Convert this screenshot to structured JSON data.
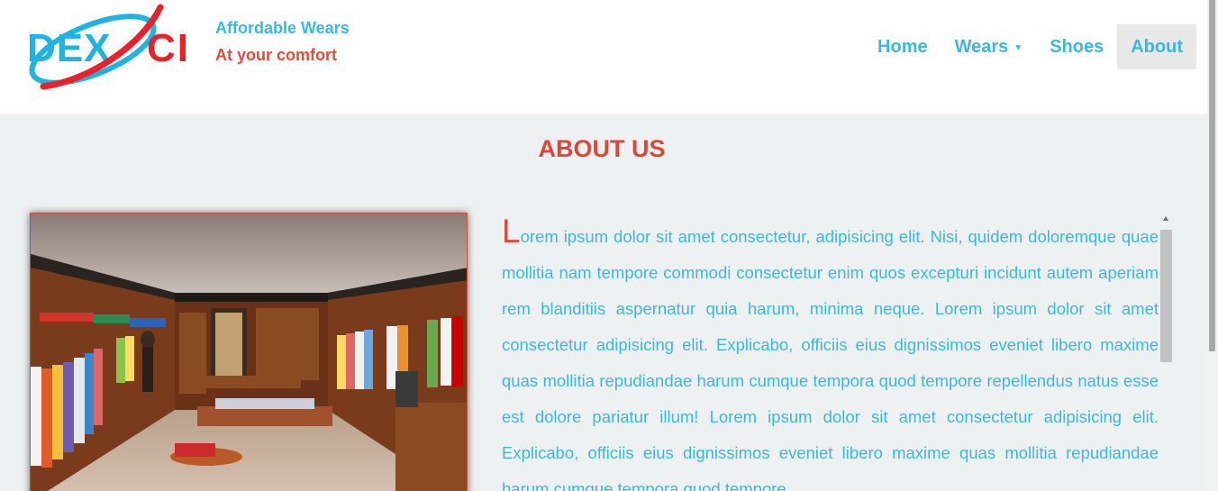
{
  "brand": {
    "logo_text_1": "DEX",
    "logo_text_2": "CI",
    "tagline_1": "Affordable Wears",
    "tagline_2": "At your comfort"
  },
  "nav": {
    "items": [
      {
        "label": "Home",
        "dropdown": false,
        "active": false
      },
      {
        "label": "Wears",
        "dropdown": true,
        "active": false
      },
      {
        "label": "Shoes",
        "dropdown": false,
        "active": false
      },
      {
        "label": "About",
        "dropdown": false,
        "active": true
      }
    ]
  },
  "about": {
    "title": "ABOUT US",
    "dropcap": "L",
    "body": "orem ipsum dolor sit amet consectetur, adipisicing elit. Nisi, quidem doloremque quae mollitia nam tempore commodi consectetur enim quos excepturi incidunt autem aperiam rem blanditiis aspernatur quia harum, minima neque. Lorem ipsum dolor sit amet consectetur adipisicing elit. Explicabo, officiis eius dignissimos eveniet libero maxime quas mollitia repudiandae harum cumque tempora quod tempore repellendus natus esse est dolore pariatur illum! Lorem ipsum dolor sit amet consectetur adipisicing elit. Explicabo, officiis eius dignissimos eveniet libero maxime quas mollitia repudiandae harum cumque tempora quod tempore"
  },
  "colors": {
    "accent_blue": "#3bb8dc",
    "accent_red": "#e14b3c",
    "background": "#eef1f2"
  },
  "icons": {
    "dropdown": "caret-down-icon",
    "scroll_up": "scroll-up-arrow-icon"
  }
}
